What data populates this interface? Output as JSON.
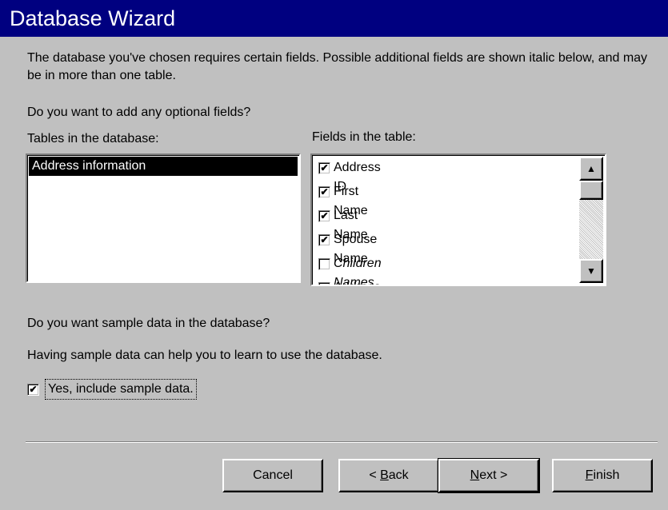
{
  "window": {
    "title": "Database Wizard"
  },
  "intro": {
    "text": "The database you've chosen requires certain fields. Possible additional fields are shown italic below, and may be in more than one table.",
    "question": "Do you want to add any optional fields?"
  },
  "tables": {
    "label": "Tables in the database:",
    "items": [
      "Address information"
    ],
    "selected": "Address information"
  },
  "fields": {
    "label": "Fields in the table:",
    "items": [
      {
        "name": "Address ID",
        "checked": true,
        "italic": false
      },
      {
        "name": "First Name",
        "checked": true,
        "italic": false
      },
      {
        "name": "Last Name",
        "checked": true,
        "italic": false
      },
      {
        "name": "Spouse Name",
        "checked": true,
        "italic": false
      },
      {
        "name": "Children Names",
        "checked": false,
        "italic": true
      },
      {
        "name": "Address",
        "checked": true,
        "italic": false
      }
    ]
  },
  "sample": {
    "question": "Do you want sample data in the database?",
    "help": "Having sample data can help you to learn to use the database.",
    "checkbox_label": "Yes, include sample data.",
    "checked": true
  },
  "buttons": {
    "cancel": "Cancel",
    "back_prefix": "< ",
    "back_accel": "B",
    "back_rest": "ack",
    "next_accel": "N",
    "next_rest": "ext >",
    "finish_accel": "F",
    "finish_rest": "inish"
  },
  "icons": {
    "scroll_up": "arrow-up-icon",
    "scroll_down": "arrow-down-icon",
    "check": "checkmark-icon"
  }
}
